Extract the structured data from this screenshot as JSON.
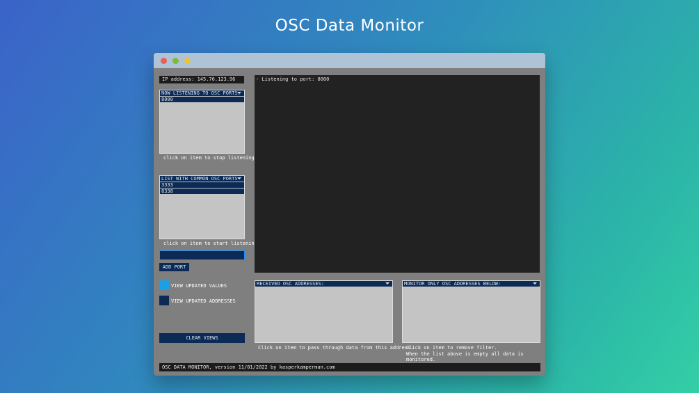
{
  "page": {
    "title": "OSC Data Monitor"
  },
  "window": {
    "ip_address": "IP address: 145.76.123.96",
    "listening": {
      "header": "NOW LISTENING TO OSC PORTS:",
      "items": [
        "8000"
      ],
      "hint": "click on item to stop listening"
    },
    "common_ports": {
      "header": "LIST WITH COMMON OSC PORTS",
      "items": [
        "3333",
        "8338"
      ],
      "hint": "click on item to start listening"
    },
    "port_input": {
      "value": ""
    },
    "add_port_label": "ADD PORT",
    "view_values": {
      "label": "VIEW UPDATED VALUES",
      "color": "#1aa0e6"
    },
    "view_addresses": {
      "label": "VIEW UPDATED ADDRESSES",
      "color": "#0b2a55"
    },
    "clear_views_label": "CLEAR VIEWS",
    "console_line": "- Listening to port: 8000",
    "received": {
      "header": "RECEIVED OSC ADDRESSES:",
      "hint": "Click on item to pass through data from this address."
    },
    "monitor_only": {
      "header": "MONITOR ONLY OSC ADDRESSES BELOW:",
      "hint_line1": "Click on item to remove filter.",
      "hint_line2": "When the list above is empty all data is monitored."
    },
    "status": "OSC DATA MONITOR, version 11/01/2022 by kasperkamperman.com"
  }
}
